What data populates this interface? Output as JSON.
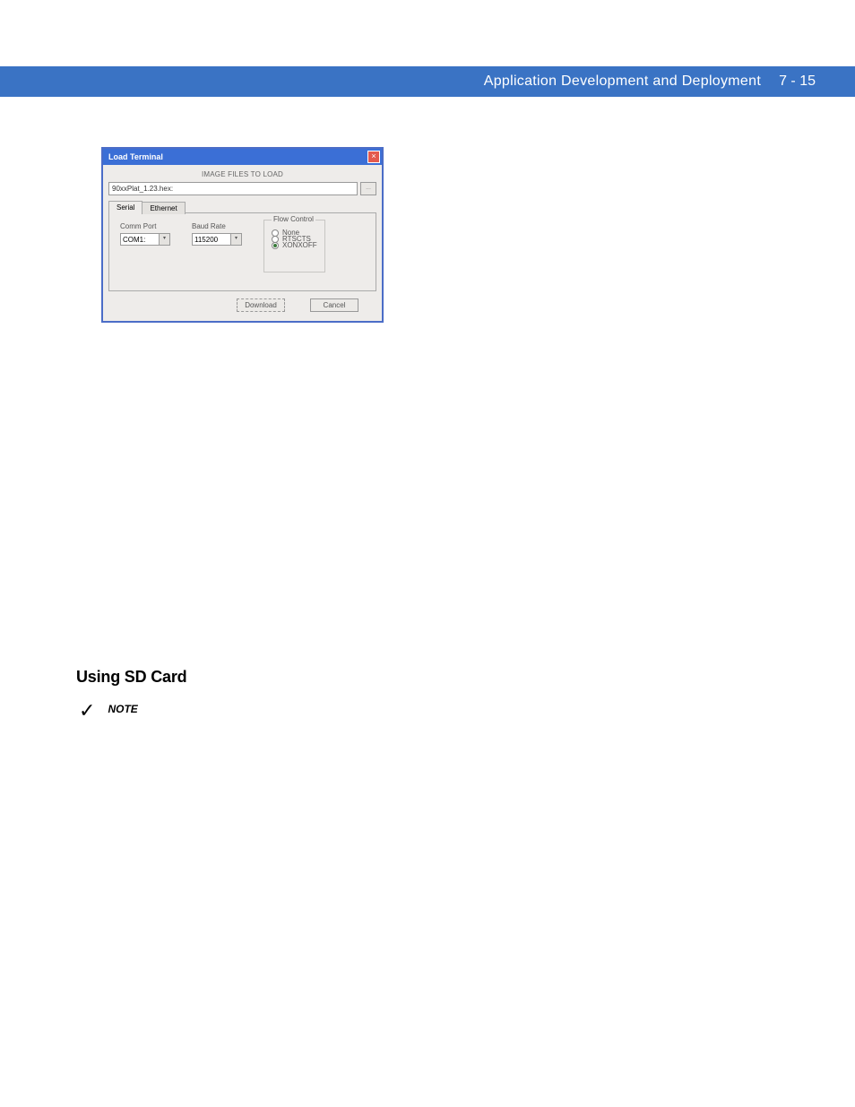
{
  "header": {
    "title": "Application Development and Deployment",
    "page_num": "7 - 15"
  },
  "dialog": {
    "title": "Load Terminal",
    "close_glyph": "×",
    "section_label": "IMAGE FILES TO LOAD",
    "file_value": "90xxPlat_1.23.hex:",
    "browse_label": "...",
    "tabs": {
      "serial": "Serial",
      "ethernet": "Ethernet"
    },
    "comm_port": {
      "label": "Comm Port",
      "value": "COM1:"
    },
    "baud_rate": {
      "label": "Baud Rate",
      "value": "115200"
    },
    "flow_control": {
      "legend": "Flow Control",
      "none": "None",
      "rtscts": "RTSCTS",
      "xonxoff": "XONXOFF"
    },
    "download_btn": "Download",
    "cancel_btn": "Cancel"
  },
  "section": {
    "heading": "Using SD Card",
    "note_label": "NOTE",
    "check_glyph": "✓"
  }
}
